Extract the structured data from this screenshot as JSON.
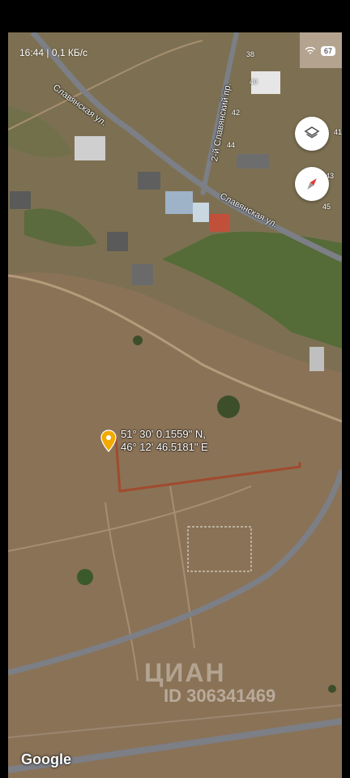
{
  "status_bar": {
    "time": "16:44",
    "speed": "0,1 КБ/с",
    "battery": "67"
  },
  "map": {
    "roads": {
      "slavyanskaya_top": "Славянская ул.",
      "slavyanskaya_right": "Славянская ул.",
      "second_slavyansky": "2-й Славянский пр."
    },
    "house_numbers": [
      "38",
      "40",
      "42",
      "44",
      "41",
      "43",
      "45"
    ],
    "marker": {
      "lat": "51° 30' 0.1559\" N,",
      "lon": "46° 12' 46.5181\" E"
    },
    "attribution": "Google",
    "watermark": "ЦИАН",
    "watermark_id": "ID 306341469",
    "colors": {
      "terrain": "#8a7257",
      "road": "#7c7f86",
      "vegetation": "#4e6a34",
      "pin": "#f2a900"
    }
  },
  "controls": {
    "layers_icon": "layers-icon",
    "compass_icon": "compass-icon"
  }
}
